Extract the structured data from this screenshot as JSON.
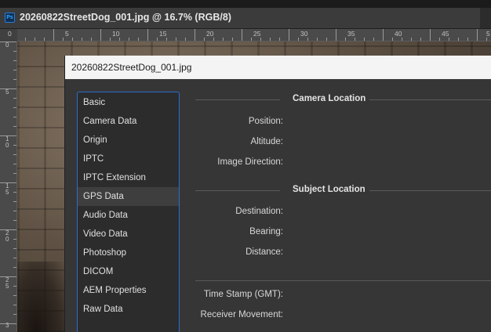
{
  "document": {
    "app_icon": "Ps",
    "tab_title": "20260822StreetDog_001.jpg @ 16.7% (RGB/8)"
  },
  "ruler": {
    "top_numbers": [
      "0",
      "5",
      "10",
      "15",
      "20",
      "25",
      "30",
      "35",
      "40",
      "45",
      "5"
    ],
    "left_numbers": [
      "0",
      "5",
      "10",
      "15",
      "20",
      "25",
      "3"
    ]
  },
  "dialog": {
    "title": "20260822StreetDog_001.jpg",
    "sidebar": [
      {
        "label": "Basic"
      },
      {
        "label": "Camera Data"
      },
      {
        "label": "Origin"
      },
      {
        "label": "IPTC"
      },
      {
        "label": "IPTC Extension"
      },
      {
        "label": "GPS Data",
        "selected": true
      },
      {
        "label": "Audio Data"
      },
      {
        "label": "Video Data"
      },
      {
        "label": "Photoshop"
      },
      {
        "label": "DICOM"
      },
      {
        "label": "AEM Properties"
      },
      {
        "label": "Raw Data"
      }
    ],
    "sections": {
      "camera_location": {
        "title": "Camera Location",
        "fields": [
          "Position:",
          "Altitude:",
          "Image Direction:"
        ]
      },
      "subject_location": {
        "title": "Subject Location",
        "fields": [
          "Destination:",
          "Bearing:",
          "Distance:"
        ]
      },
      "other": {
        "fields": [
          "Time Stamp (GMT):",
          "Receiver Movement:"
        ]
      }
    }
  },
  "colors": {
    "accent": "#2a6fd0",
    "ps_blue": "#31a8ff"
  }
}
